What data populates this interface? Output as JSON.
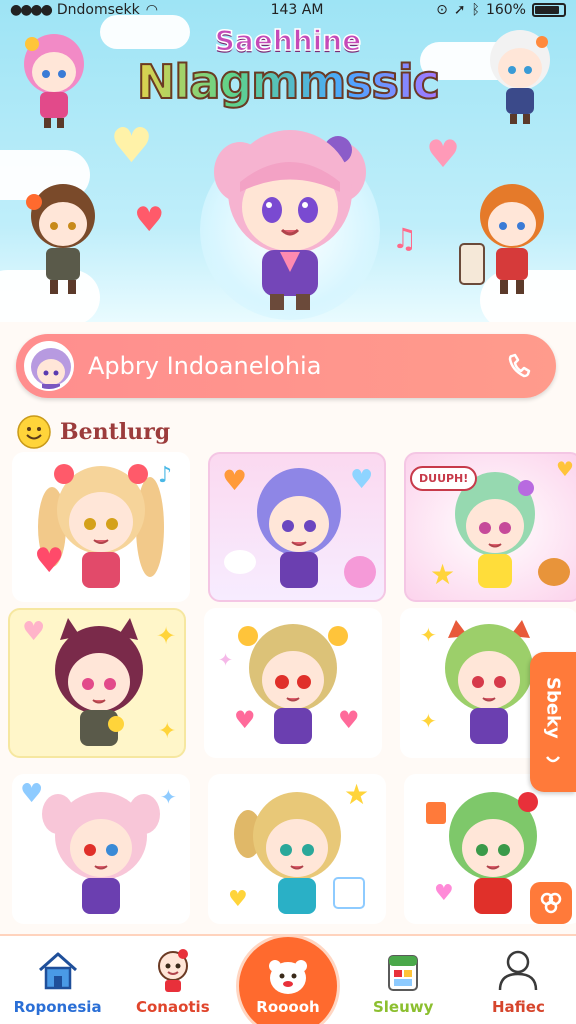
{
  "status_bar": {
    "carrier": "Dndomsekk",
    "time": "143 AM",
    "battery": "160%"
  },
  "hero": {
    "subtitle": "Saehhine",
    "title": "Nlagmmssic"
  },
  "search": {
    "placeholder": "Apbry Indoanelohia"
  },
  "section": {
    "title": "Bentlurg"
  },
  "grid": {
    "speech_bubble": "DUUPH!"
  },
  "side_tab": {
    "label": "Sbeky"
  },
  "bottom_nav": {
    "items": [
      {
        "label": "Roponesia",
        "icon": "home-icon",
        "color": "#2b6fd6"
      },
      {
        "label": "Conaotis",
        "icon": "character-icon",
        "color": "#e0452c"
      },
      {
        "label": "Rooooh",
        "icon": "bear-face-icon",
        "color": "#ffffff"
      },
      {
        "label": "Sleuwy",
        "icon": "box-icon",
        "color": "#8cbf2f"
      },
      {
        "label": "Hafiec",
        "icon": "profile-icon",
        "color": "#d6452c"
      }
    ]
  },
  "colors": {
    "accent": "#ff6a2e",
    "search_bar": "#ff8e8e",
    "hero_sky": "#9ee4f5"
  }
}
